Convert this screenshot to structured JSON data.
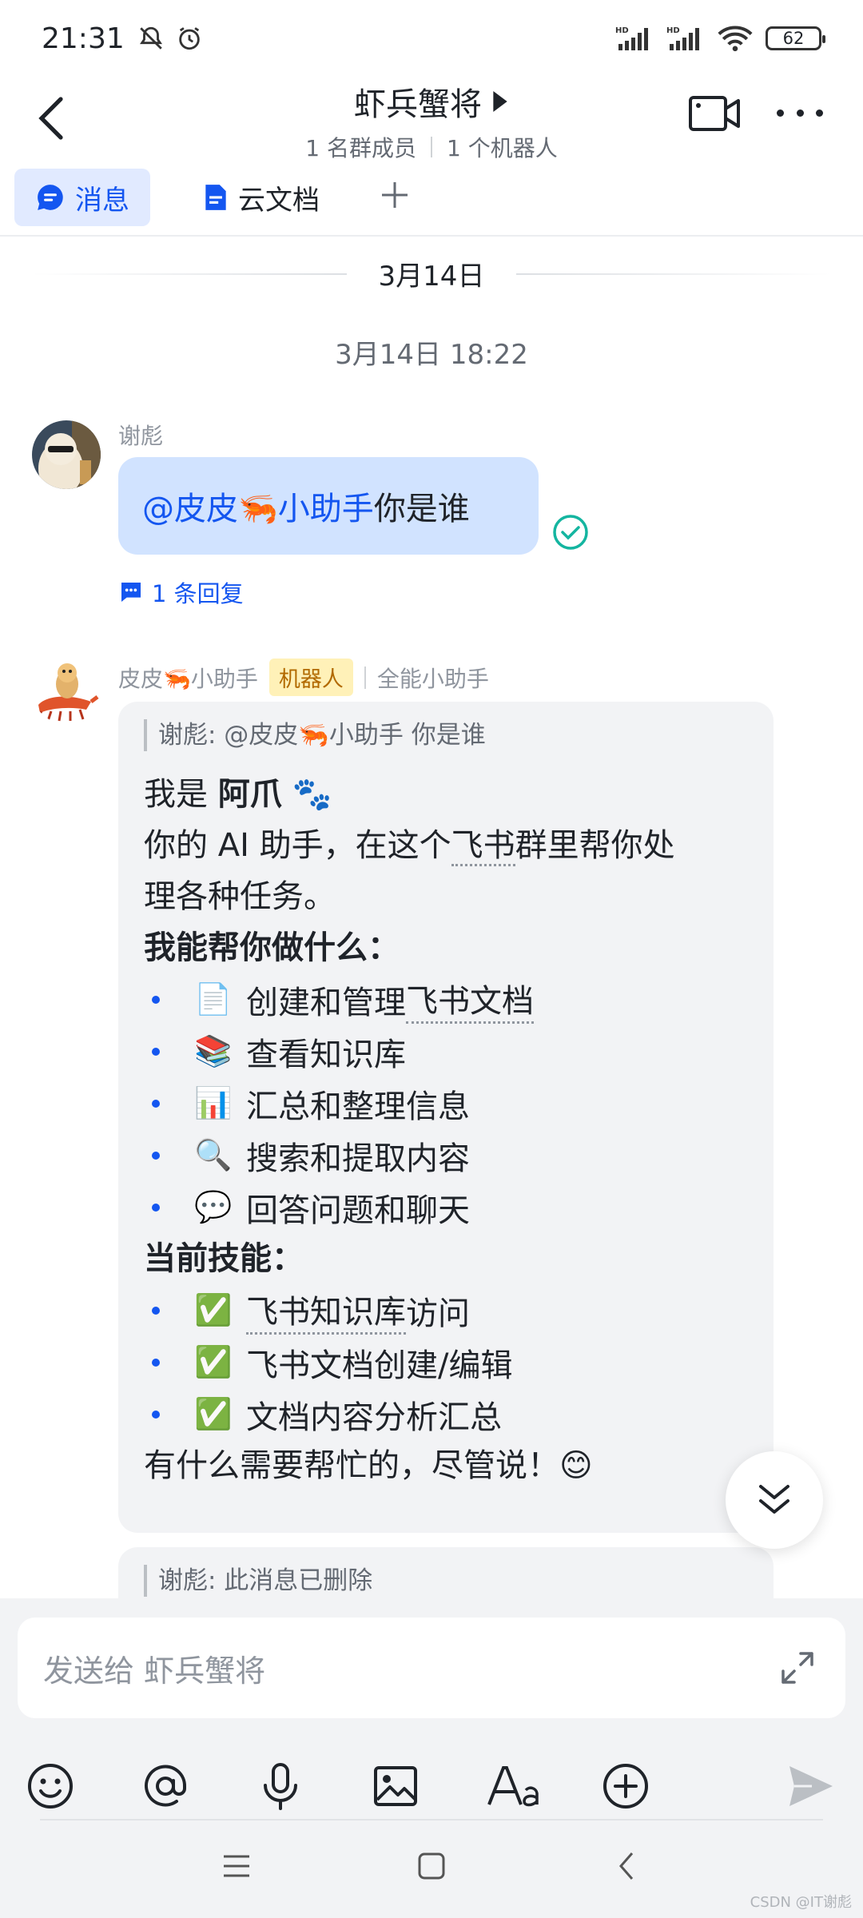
{
  "status_bar": {
    "time": "21:31",
    "battery": "62",
    "net_label": "HD"
  },
  "header": {
    "title": "虾兵蟹将",
    "members": "1 名群成员",
    "bots": "1 个机器人"
  },
  "tabs": [
    {
      "label": "消息",
      "icon": "chat-bubble-icon",
      "active": true
    },
    {
      "label": "云文档",
      "icon": "doc-icon",
      "active": false
    }
  ],
  "chat": {
    "date_divider": "3月14日",
    "timestamp": "3月14日 18:22",
    "user_message": {
      "sender": "谢彪",
      "mention": "@皮皮🦐小助手",
      "text": " 你是谁",
      "reply_count": "1 条回复"
    },
    "bot_message": {
      "sender": "皮皮🦐小助手",
      "badge": "机器人",
      "description": "全能小助手",
      "quote": "谢彪: @皮皮🦐小助手 你是谁",
      "intro_prefix": "我是 ",
      "intro_name": "阿爪",
      "intro_emoji": "🐾",
      "intro_line2_a": "你的 AI 助手，在这个",
      "intro_line2_link": "飞书",
      "intro_line2_b": "群里帮你处",
      "intro_line3": "理各种任务。",
      "capabilities_title": "我能帮你做什么：",
      "capabilities": [
        {
          "emoji": "📄",
          "text_a": "创建和管理",
          "text_link": "飞书文档"
        },
        {
          "emoji": "📚",
          "text_a": "查看知识库",
          "text_link": ""
        },
        {
          "emoji": "📊",
          "text_a": "汇总和整理信息",
          "text_link": ""
        },
        {
          "emoji": "🔍",
          "text_a": "搜索和提取内容",
          "text_link": ""
        },
        {
          "emoji": "💬",
          "text_a": "回答问题和聊天",
          "text_link": ""
        }
      ],
      "skills_title": "当前技能：",
      "skills": [
        {
          "emoji": "✅",
          "text_link": "飞书知识库",
          "text_a": "访问"
        },
        {
          "emoji": "✅",
          "text_link": "",
          "text_a": "飞书文档创建/编辑"
        },
        {
          "emoji": "✅",
          "text_link": "",
          "text_a": "文档内容分析汇总"
        }
      ],
      "closing": "有什么需要帮忙的，尽管说！😊"
    },
    "next_quote": "谢彪: 此消息已删除"
  },
  "composer": {
    "placeholder": "发送给 虾兵蟹将"
  },
  "watermark": "CSDN @IT谢彪",
  "colors": {
    "accent": "#1456f0",
    "user_bubble": "#d1e3ff",
    "bot_bubble": "#f2f3f5",
    "bot_badge": "#fff1b8",
    "read_check": "#14b5a0"
  }
}
